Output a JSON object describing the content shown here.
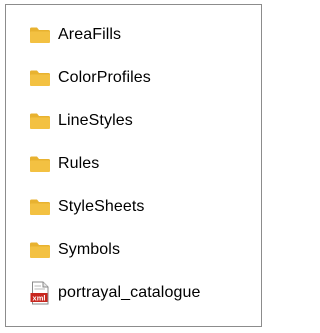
{
  "colors": {
    "folder": "#f3c142",
    "folder_tab": "#e8b230",
    "xml_badge": "#c8271f"
  },
  "items": [
    {
      "name": "AreaFills",
      "icon": "folder-icon"
    },
    {
      "name": "ColorProfiles",
      "icon": "folder-icon"
    },
    {
      "name": "LineStyles",
      "icon": "folder-icon"
    },
    {
      "name": "Rules",
      "icon": "folder-icon"
    },
    {
      "name": "StyleSheets",
      "icon": "folder-icon"
    },
    {
      "name": "Symbols",
      "icon": "folder-icon"
    },
    {
      "name": "portrayal_catalogue",
      "icon": "xml-file-icon",
      "badge": "xml"
    }
  ]
}
